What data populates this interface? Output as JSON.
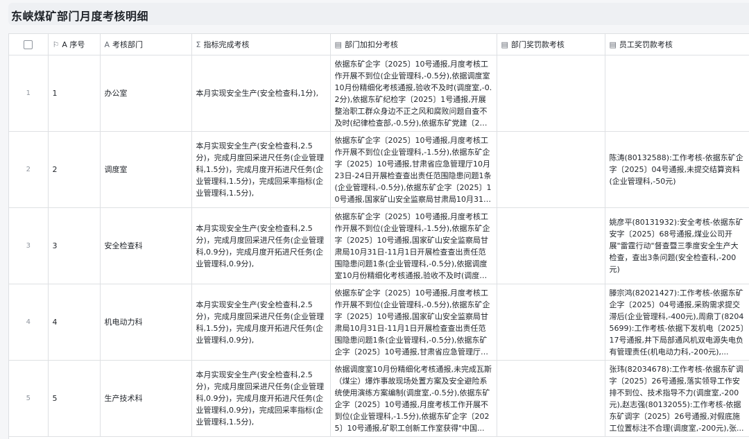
{
  "page": {
    "title": "东峡煤矿部门月度考核明细"
  },
  "columns": {
    "seq": {
      "icon": "⚐",
      "label": "A 序号"
    },
    "dept": {
      "icon": "A",
      "label": "考核部门"
    },
    "indicator": {
      "icon": "Σ",
      "label": "指标完成考核"
    },
    "bonus": {
      "icon": "▤",
      "label": "部门加扣分考核"
    },
    "dept_reward": {
      "icon": "▤",
      "label": "部门奖罚款考核"
    },
    "staff_reward": {
      "icon": "▤",
      "label": "员工奖罚款考核"
    }
  },
  "rows": [
    {
      "rownum": "1",
      "seq": "1",
      "dept": "办公室",
      "indicator": "本月实现安全生产(安全检查科,1分),",
      "bonus": "依据东矿企字〔2025〕10号通报,月度考核工作开展不到位(企业管理科,-0.5分),依据调度室10月份精细化考核通报,验收不及时(调度室,-0.2分),依据东矿纪检字〔2025〕1号通报,开展整治职工群众身边不正之风和腐败问题自查不及时(纪律检查部,-0.5分),依据东矿党建〔2025...",
      "dept_reward": "",
      "staff_reward": ""
    },
    {
      "rownum": "2",
      "seq": "2",
      "dept": "调度室",
      "indicator": "本月实现安全生产(安全检查科,2.5分)，完成月度回采进尺任务(企业管理科,1.5分)，完成月度开拓进尺任务(企业管理科,1.5分)，完成回采率指标(企业管理科,1.5分),",
      "bonus": "依据东矿企字〔2025〕10号通报,月度考核工作开展不到位(企业管理科,-1.5分),依据东矿企字〔2025〕10号通报,甘肃省应急管理厅10月23日-24日开展检查查出责任范围隐患问题1条(企业管理科,-0.5分),依据东矿企字〔2025〕10号通报,国家矿山安全监察局甘肃局10月31日...",
      "dept_reward": "",
      "staff_reward": "陈涛(80132588):工作考核-依据东矿企字〔2025〕04号通报,未提交结算资料(企业管理科,-50元)"
    },
    {
      "rownum": "3",
      "seq": "3",
      "dept": "安全检查科",
      "indicator": "本月实现安全生产(安全检查科,2.5分)，完成月度回采进尺任务(企业管理科,0.9分)，完成月度开拓进尺任务(企业管理科,0.9分),",
      "bonus": "依据东矿企字〔2025〕10号通报,月度考核工作开展不到位(企业管理科,-1.5分),依据东矿企字〔2025〕10号通报,国家矿山安全监察局甘肃局10月31日-11月1日开展检查查出责任范围隐患问题1条(企业管理科,-0.5分),依据调度室10月份精细化考核通报,验收不及时(调度室,-0...",
      "dept_reward": "",
      "staff_reward": "姚彦平(80131932):安全考核-依据东矿安字〔2025〕68号通报,煤业公司开展\"雷霆行动\"督查暨三季度安全生产大检查，查出3条问题(安全检查科,-200元)"
    },
    {
      "rownum": "4",
      "seq": "4",
      "dept": "机电动力科",
      "indicator": "本月实现安全生产(安全检查科,2.5分)，完成月度回采进尺任务(企业管理科,1.5分)，完成月度开拓进尺任务(企业管理科,0.9分),",
      "bonus": "依据东矿企字〔2025〕10号通报,月度考核工作开展不到位(企业管理科,-0.5分),依据东矿企字〔2025〕10号通报,国家矿山安全监察局甘肃局10月31日-11月1日开展检查查出责任范围隐患问题1条(企业管理科,-0.5分),依据东矿企字〔2025〕10号通报,甘肃省应急管理厅10...",
      "dept_reward": "",
      "staff_reward": "滕宗鸿(82021427):工作考核-依据东矿企字〔2025〕04号通报,采购需求提交滞后(企业管理科,-400元),周鼎丁(82045699):工作考核-依据下发机电〔2025〕17号通报,井下局部通风机双电源失电负有管理责任(机电动力科,-200元),..."
    },
    {
      "rownum": "5",
      "seq": "5",
      "dept": "生产技术科",
      "indicator": "本月实现安全生产(安全检查科,2.5分)，完成月度回采进尺任务(企业管理科,0.9分)，完成月度开拓进尺任务(企业管理科,0.9分)，完成回采率指标(企业管理科,1.5分),",
      "bonus": "依据调度室10月份精细化考核通报,未完成瓦斯（煤尘）爆炸事故现场处置方案及安全避险系统使用演练方案编制(调度室,-0.5分),依据东矿企字〔2025〕10号通报,月度考核工作开展不到位(企业管理科,-1.5分),依据东矿企字〔2025〕10号通报,矿职工创新工作室获得\"中国...",
      "dept_reward": "",
      "staff_reward": "张玮(82034678):工作考核-依据东矿调字〔2025〕26号通报,落实领导工作安排不到位、技术指导不力(调度室,-200元),赵志强(80132055):工作考核-依据东矿调字〔2025〕26号通报,对假底施工位置标注不合理(调度室,-200元),张..."
    }
  ]
}
